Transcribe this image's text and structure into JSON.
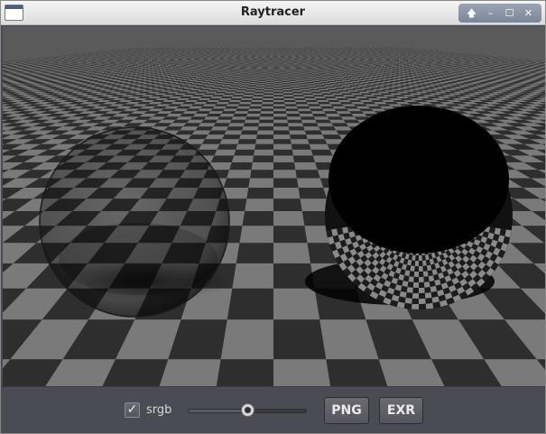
{
  "window": {
    "title": "Raytracer"
  },
  "titlebar_buttons": [
    {
      "name": "up-arrow-icon",
      "glyph": "🡅"
    },
    {
      "name": "minimize-icon",
      "glyph": "–"
    },
    {
      "name": "maximize-icon",
      "glyph": "☐"
    },
    {
      "name": "close-icon",
      "glyph": "✕"
    }
  ],
  "controls": {
    "srgb_checkbox": {
      "label": "srgb",
      "checked": true,
      "check_glyph": "✓"
    },
    "slider": {
      "value_fraction": 0.5
    },
    "png_button": "PNG",
    "exr_button": "EXR"
  },
  "scene": {
    "checker_light": "#7a7a7a",
    "checker_dark": "#2e2e2e",
    "sky": "#5a5a5a"
  }
}
